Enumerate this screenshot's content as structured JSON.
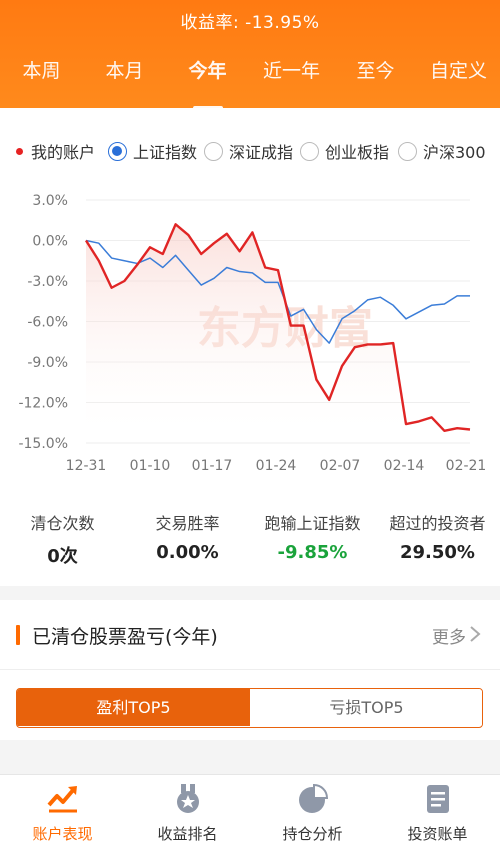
{
  "header": {
    "title": "收益率: -13.95%"
  },
  "tabs": [
    {
      "label": "本周"
    },
    {
      "label": "本月"
    },
    {
      "label": "今年",
      "active": true
    },
    {
      "label": "近一年"
    },
    {
      "label": "至今"
    },
    {
      "label": "自定义"
    }
  ],
  "legend": {
    "my_account": "我的账户",
    "indices": [
      {
        "label": "上证指数",
        "selected": true
      },
      {
        "label": "深证成指",
        "selected": false
      },
      {
        "label": "创业板指",
        "selected": false
      },
      {
        "label": "沪深300",
        "selected": false
      }
    ]
  },
  "watermark": "东方财富",
  "chart_data": {
    "type": "line",
    "y_ticks": [
      "3.0%",
      "0.0%",
      "-3.0%",
      "-6.0%",
      "-9.0%",
      "-12.0%",
      "-15.0%"
    ],
    "x_ticks": [
      "12-31",
      "01-10",
      "01-17",
      "01-24",
      "02-07",
      "02-14",
      "02-21"
    ],
    "ylim": [
      -15,
      3
    ],
    "series": [
      {
        "name": "我的账户",
        "color": "#e02525",
        "values": [
          0,
          -1.5,
          -3.5,
          -3.0,
          -1.8,
          -0.5,
          -1.0,
          1.2,
          0.4,
          -1.0,
          -0.2,
          0.5,
          -0.8,
          0.6,
          -2.0,
          -2.2,
          -6.3,
          -6.3,
          -10.3,
          -11.8,
          -9.3,
          -7.9,
          -7.7,
          -7.7,
          -7.6,
          -13.6,
          -13.4,
          -13.1,
          -14.1,
          -13.9,
          -14.0
        ]
      },
      {
        "name": "上证指数",
        "color": "#3b7dd8",
        "values": [
          0,
          -0.2,
          -1.3,
          -1.5,
          -1.7,
          -1.3,
          -2.0,
          -1.1,
          -2.2,
          -3.3,
          -2.8,
          -2.0,
          -2.3,
          -2.4,
          -3.1,
          -3.1,
          -5.6,
          -5.1,
          -6.6,
          -7.6,
          -5.8,
          -5.2,
          -4.4,
          -4.2,
          -4.8,
          -5.8,
          -5.3,
          -4.8,
          -4.7,
          -4.1,
          -4.1
        ]
      }
    ]
  },
  "stats": [
    {
      "label": "清仓次数",
      "value": "0次"
    },
    {
      "label": "交易胜率",
      "value": "0.00%"
    },
    {
      "label": "跑输上证指数",
      "value": "-9.85%",
      "color": "#1aa33b"
    },
    {
      "label": "超过的投资者",
      "value": "29.50%"
    }
  ],
  "section": {
    "title": "已清仓股票盈亏(今年)",
    "more": "更多",
    "seg_profit": "盈利TOP5",
    "seg_loss": "亏损TOP5"
  },
  "bottom_nav": [
    {
      "label": "账户表现",
      "icon": "chart-trend-icon",
      "active": true
    },
    {
      "label": "收益排名",
      "icon": "medal-icon"
    },
    {
      "label": "持仓分析",
      "icon": "pie-chart-icon"
    },
    {
      "label": "投资账单",
      "icon": "document-icon"
    }
  ],
  "colors": {
    "accent": "#ff7a12",
    "green": "#1aa33b",
    "red": "#e02525",
    "blue": "#3b7dd8"
  }
}
